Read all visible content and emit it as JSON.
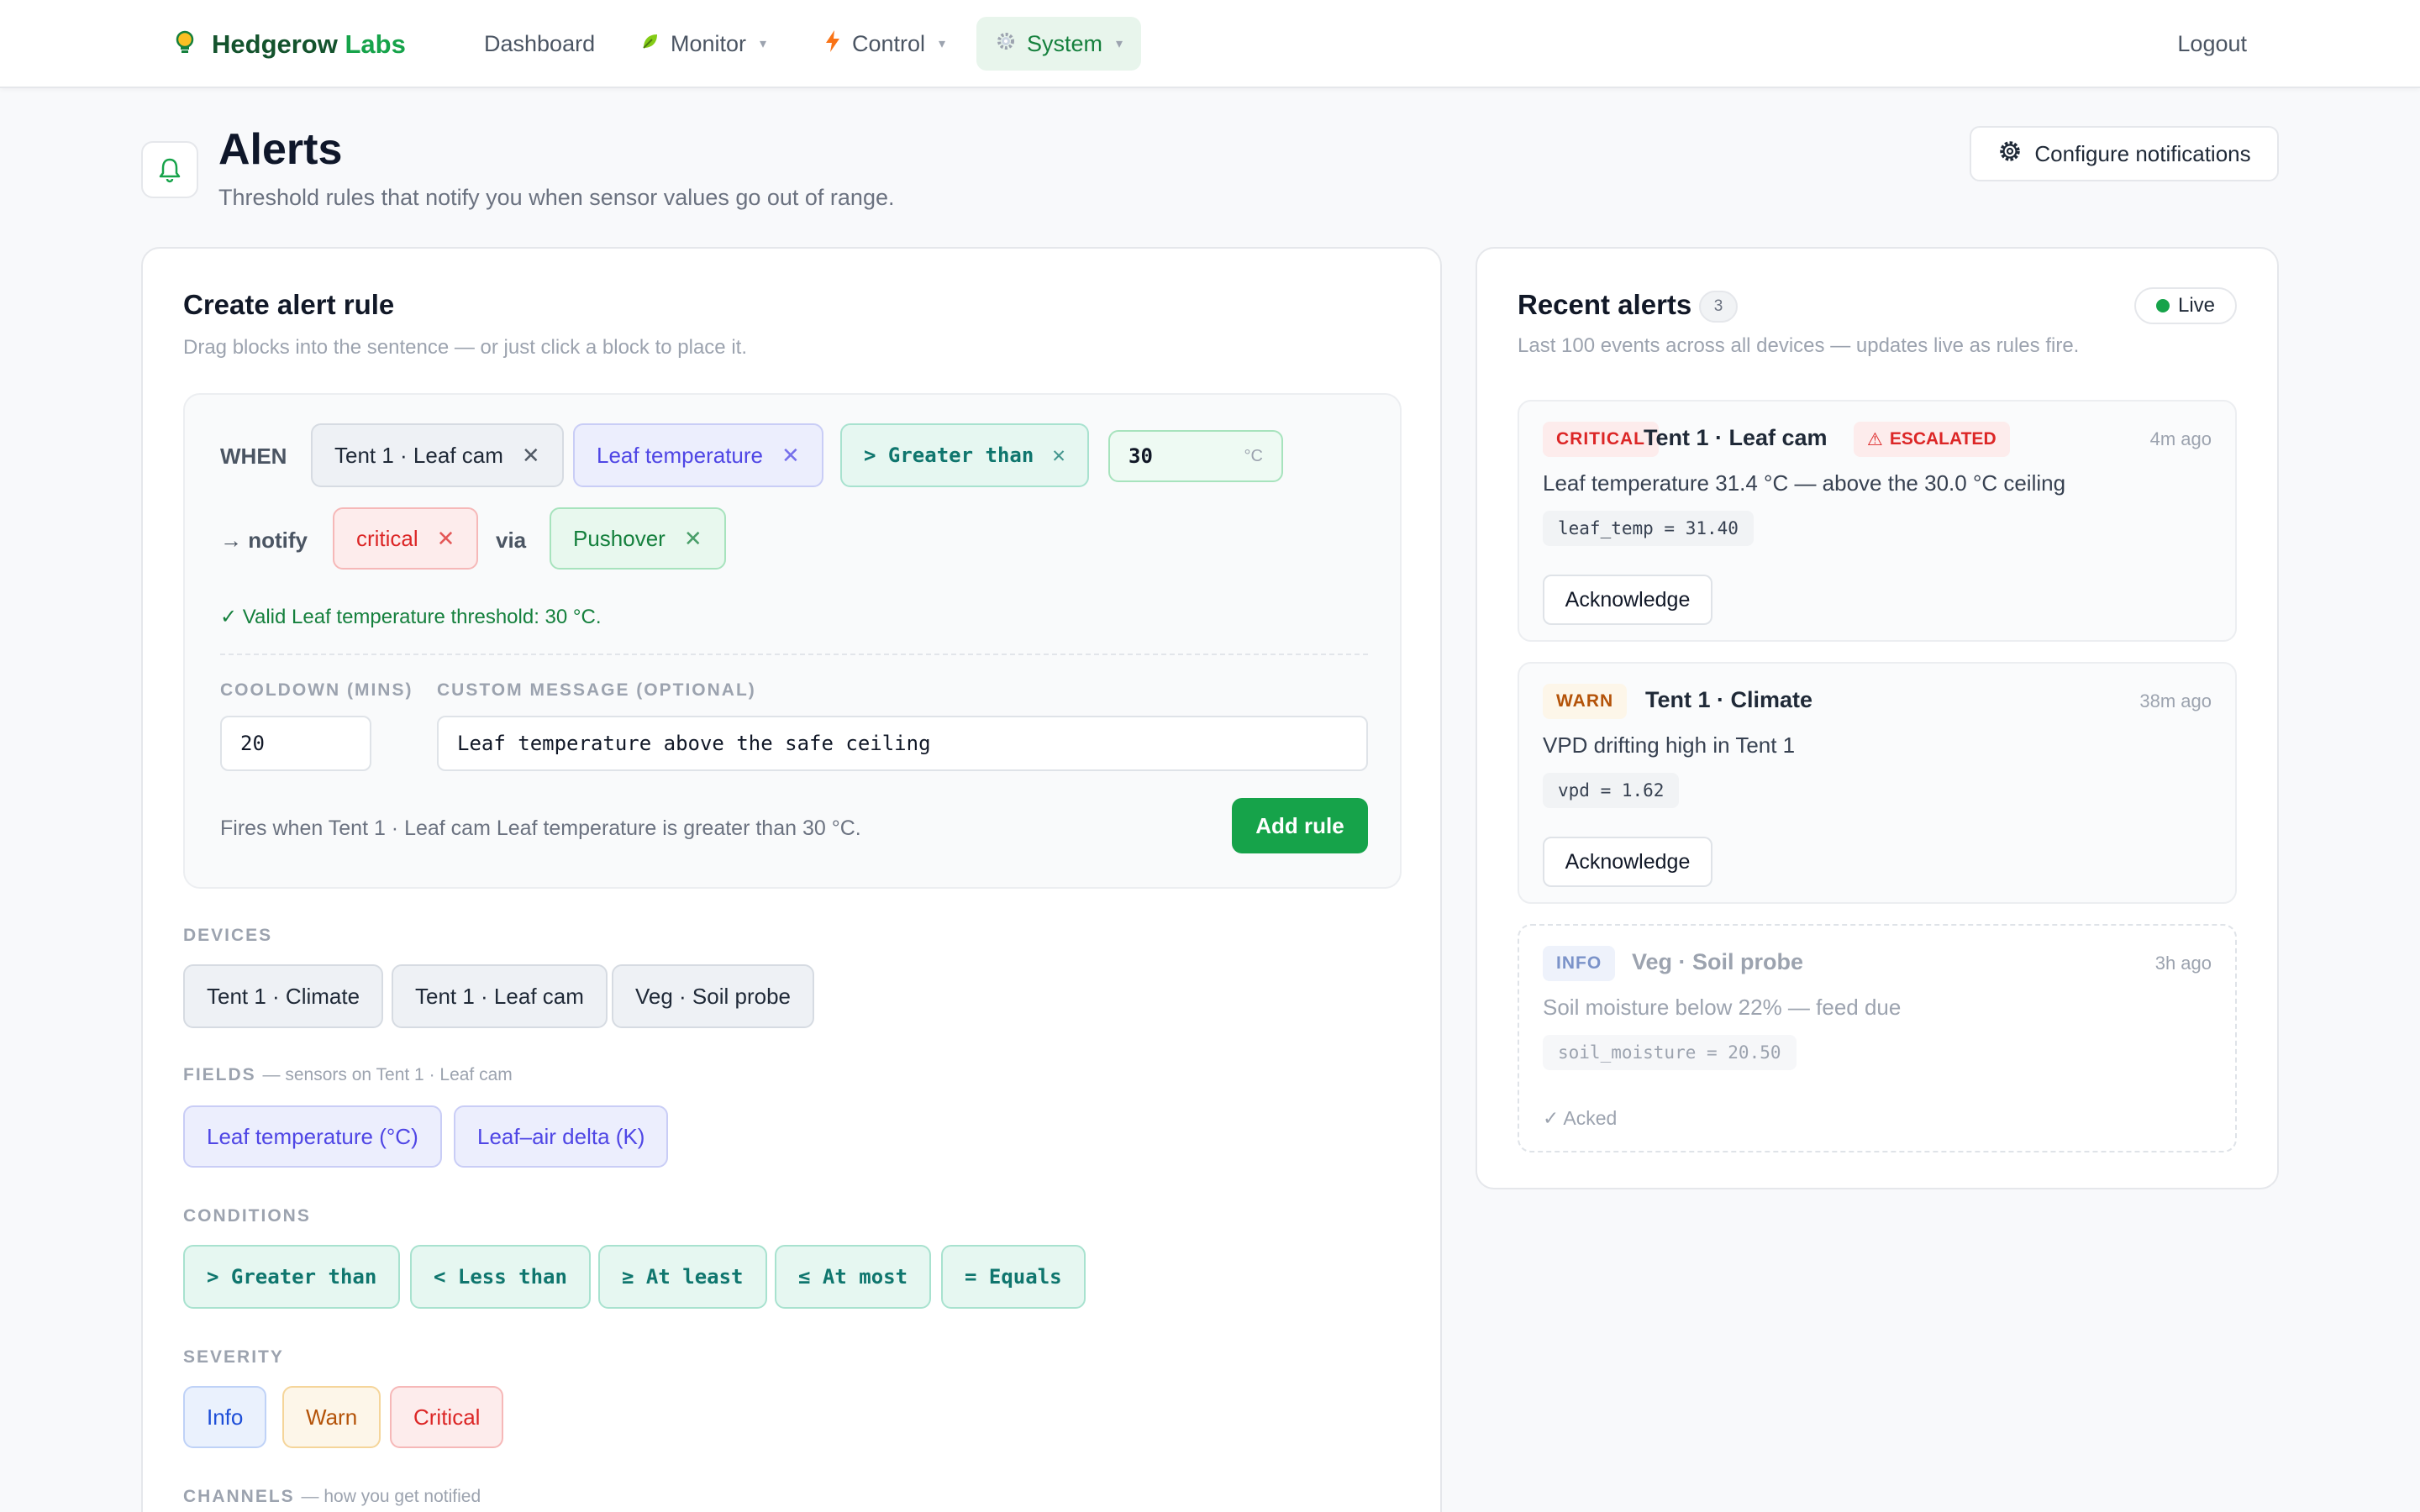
{
  "nav": {
    "brand_part1": "Hedgerow",
    "brand_part2": "Labs",
    "links": [
      {
        "label": "Dashboard"
      },
      {
        "label": "Monitor"
      },
      {
        "label": "Control"
      },
      {
        "label": "System"
      }
    ],
    "logout": "Logout"
  },
  "header": {
    "title": "Alerts",
    "subtitle": "Threshold rules that notify you when sensor values go out of range.",
    "configure_label": "Configure notifications"
  },
  "create": {
    "title": "Create alert rule",
    "subtitle": "Drag blocks into the sentence — or just click a block to place it.",
    "when_label": "WHEN",
    "device": "Tent 1 · Leaf cam",
    "field": "Leaf temperature",
    "condition": "> Greater than",
    "threshold_value": "30",
    "threshold_unit": "°C",
    "notify_label": "→ notify",
    "severity": "critical",
    "via_label": "via",
    "channel": "Pushover",
    "close_glyph": "✕",
    "valid_message": "✓ Valid Leaf temperature threshold: 30 °C.",
    "cooldown_label": "COOLDOWN (MINS)",
    "cooldown_value": "20",
    "message_label": "CUSTOM MESSAGE (OPTIONAL)",
    "message_value": "Leaf temperature above the safe ceiling",
    "summary": "Fires when Tent 1 · Leaf cam Leaf temperature is greater than 30 °C.",
    "add_label": "Add rule"
  },
  "palette": {
    "devices_label": "DEVICES",
    "devices": [
      "Tent 1 · Climate",
      "Tent 1 · Leaf cam",
      "Veg · Soil probe"
    ],
    "fields_label": "FIELDS",
    "fields_note": "— sensors on Tent 1 · Leaf cam",
    "fields": [
      "Leaf temperature (°C)",
      "Leaf–air delta (K)"
    ],
    "conditions_label": "CONDITIONS",
    "conditions": [
      "> Greater than",
      "< Less than",
      "≥ At least",
      "≤ At most",
      "= Equals"
    ],
    "severity_label": "SEVERITY",
    "severities": [
      "Info",
      "Warn",
      "Critical"
    ],
    "channels_label": "CHANNELS",
    "channels_note": "— how you get notified"
  },
  "recent": {
    "title": "Recent alerts",
    "count": "3",
    "live_label": "Live",
    "subtitle": "Last 100 events across all devices — updates live as rules fire.",
    "ack_label": "Acknowledge",
    "alerts": [
      {
        "severity": "CRITICAL",
        "device": "Tent 1 · Leaf cam",
        "escalated": "ESCALATED",
        "time": "4m ago",
        "message": "Leaf temperature 31.4 °C — above the 30.0 °C ceiling",
        "reading": "leaf_temp = 31.40"
      },
      {
        "severity": "WARN",
        "device": "Tent 1 · Climate",
        "time": "38m ago",
        "message": "VPD drifting high in Tent 1",
        "reading": "vpd = 1.62"
      },
      {
        "severity": "INFO",
        "device": "Veg · Soil probe",
        "time": "3h ago",
        "message": "Soil moisture below 22% — feed due",
        "reading": "soil_moisture = 20.50",
        "acked": "✓ Acked"
      }
    ]
  },
  "colors": {
    "brand": "#16a34a",
    "critical": "#dc2626",
    "warn": "#b45309",
    "info": "#1d4ed8",
    "field": "#4f46e5",
    "condition": "#0f766e"
  },
  "icons": {
    "brand": "lightbulb-icon",
    "monitor": "leaf-icon",
    "control": "lightning-icon",
    "system": "gear-icon",
    "header": "bell-icon",
    "configure": "gear-icon",
    "escalated": "warning-icon"
  }
}
